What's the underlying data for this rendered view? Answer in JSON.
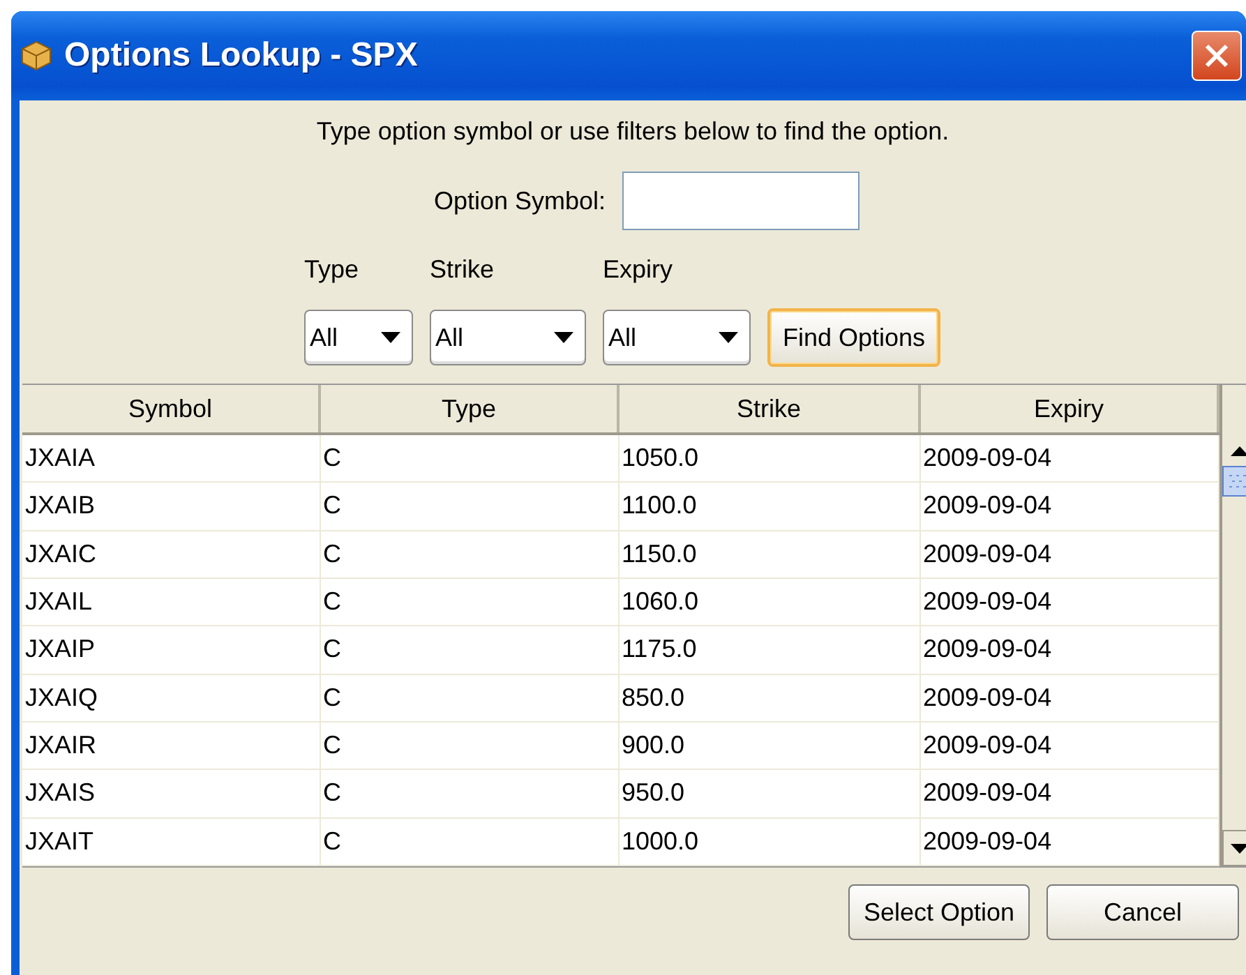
{
  "window": {
    "title": "Options Lookup - SPX"
  },
  "instructions": "Type option symbol or use filters below to find the option.",
  "option_symbol": {
    "label": "Option Symbol:"
  },
  "filters": [
    {
      "label": "Type",
      "value": "All"
    },
    {
      "label": "Strike",
      "value": "All"
    },
    {
      "label": "Expiry",
      "value": "All"
    }
  ],
  "find_button": {
    "label": "Find Options",
    "highlighted": true
  },
  "table": {
    "columns": [
      "Symbol",
      "Type",
      "Strike",
      "Expiry"
    ],
    "rows": [
      [
        "JXAIA",
        "C",
        "1050.0",
        "2009-09-04"
      ],
      [
        "JXAIB",
        "C",
        "1100.0",
        "2009-09-04"
      ],
      [
        "JXAIC",
        "C",
        "1150.0",
        "2009-09-04"
      ],
      [
        "JXAIL",
        "C",
        "1060.0",
        "2009-09-04"
      ],
      [
        "JXAIP",
        "C",
        "1175.0",
        "2009-09-04"
      ],
      [
        "JXAIQ",
        "C",
        "850.0",
        "2009-09-04"
      ],
      [
        "JXAIR",
        "C",
        "900.0",
        "2009-09-04"
      ],
      [
        "JXAIS",
        "C",
        "950.0",
        "2009-09-04"
      ],
      [
        "JXAIT",
        "C",
        "1000.0",
        "2009-09-04"
      ]
    ]
  },
  "buttons": [
    "Select Option",
    "Cancel"
  ]
}
